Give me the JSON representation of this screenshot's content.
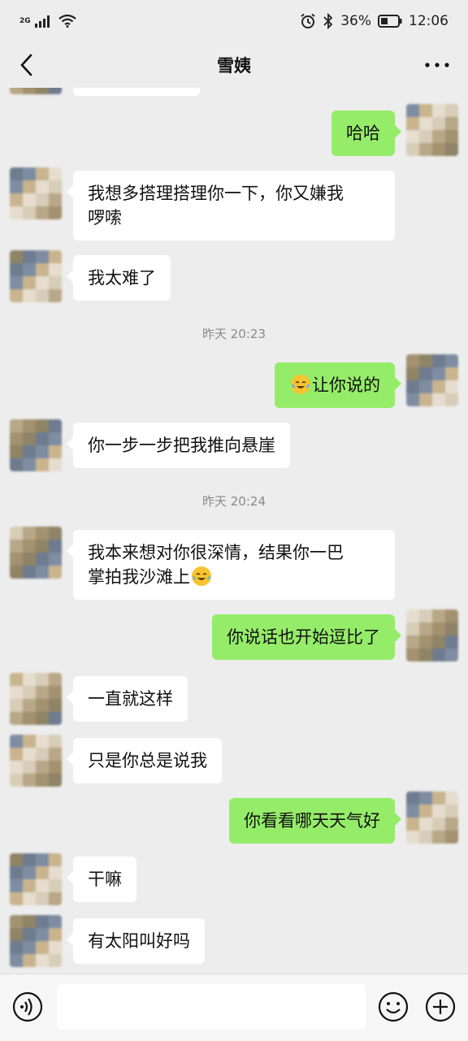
{
  "status_bar": {
    "network_type": "2G",
    "battery_percent": "36%",
    "time": "12:06",
    "icons": [
      "signal-icon",
      "wifi-icon",
      "alarm-icon",
      "bluetooth-icon",
      "battery-icon"
    ]
  },
  "header": {
    "title": "雪姨",
    "back_icon": "chevron-left-icon",
    "more_icon": "more-dots-icon"
  },
  "timestamps": [
    "昨天 20:23",
    "昨天 20:24"
  ],
  "messages": [
    {
      "side": "out",
      "text": "哈哈"
    },
    {
      "side": "in",
      "text": "我想多搭理搭理你一下，你又嫌我",
      "text2": "啰嗦"
    },
    {
      "side": "in",
      "text": "我太难了"
    },
    {
      "side": "out",
      "text": "让你说的",
      "emoji": "laughing-crying-emoji"
    },
    {
      "side": "in",
      "text": "你一步一步把我推向悬崖"
    },
    {
      "side": "in",
      "text": "我本来想对你很深情，结果你一巴",
      "text2": "掌拍我沙滩上",
      "emoji": "laughing-crying-emoji"
    },
    {
      "side": "out",
      "text": "你说话也开始逗比了"
    },
    {
      "side": "in",
      "text": "一直就这样"
    },
    {
      "side": "in",
      "text": "只是你总是说我"
    },
    {
      "side": "out",
      "text": "你看看哪天天气好"
    },
    {
      "side": "in",
      "text": "干嘛"
    },
    {
      "side": "in",
      "text": "有太阳叫好吗"
    }
  ],
  "input_bar": {
    "placeholder": "",
    "icons": [
      "voice-icon",
      "emoji-icon",
      "plus-icon"
    ]
  },
  "colors": {
    "background": "#ededed",
    "outgoing_bubble": "#95ec69",
    "incoming_bubble": "#ffffff",
    "timestamp_text": "#8a8a8a"
  }
}
